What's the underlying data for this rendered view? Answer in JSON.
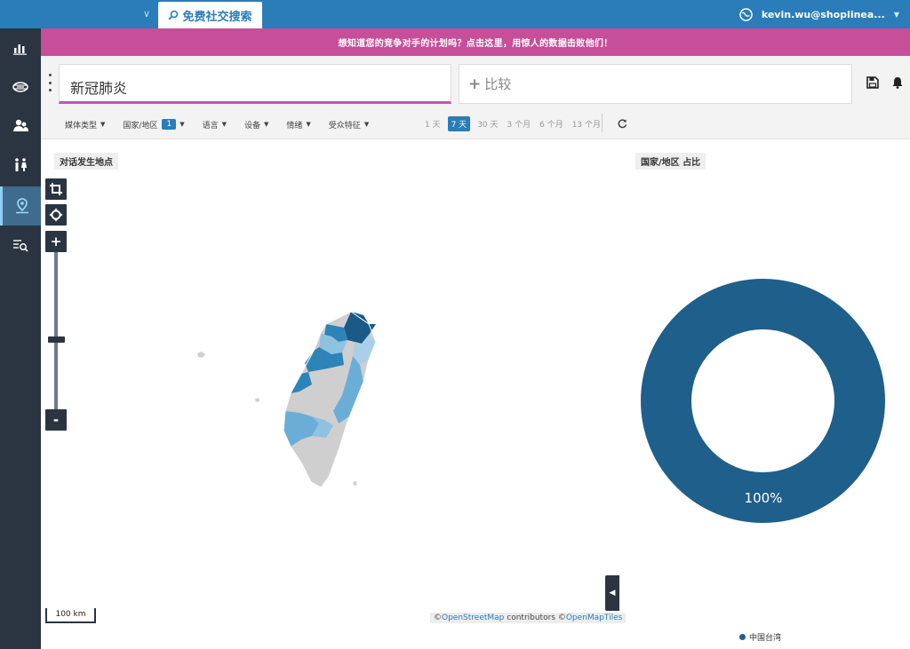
{
  "topbar": {
    "search_tab_label": "免费社交搜索",
    "user_email": "kevin.wu@shoplinea..."
  },
  "banner": {
    "text": "想知道您的竞争对手的计划吗？点击这里，用惊人的数据击败他们！"
  },
  "query": {
    "main_query": "新冠肺炎",
    "compare_label": "比较"
  },
  "filters": [
    {
      "label": "媒体类型"
    },
    {
      "label": "国家/地区",
      "badge": "1"
    },
    {
      "label": "语言"
    },
    {
      "label": "设备"
    },
    {
      "label": "情绪"
    },
    {
      "label": "受众特征"
    }
  ],
  "periods": {
    "options": [
      "1 天",
      "7 天",
      "30 天",
      "3 个月",
      "6 个月",
      "13 个月"
    ],
    "selected": "7 天"
  },
  "map_panel": {
    "title": "对话发生地点",
    "zoom_in": "+",
    "zoom_out": "-",
    "zoom_level": 0.55,
    "scale_label": "100 km",
    "attribution": {
      "prefix1": "©",
      "osm": "OpenStreetMap",
      "mid": " contributors ",
      "prefix2": "©",
      "omt": "OpenMapTiles"
    }
  },
  "donut_panel": {
    "title": "国家/地区 占比",
    "slice_value": 100,
    "slice_label": "100%",
    "legend_label": "中国台湾",
    "slice_color": "#1f5f8b"
  },
  "colors": {
    "topbar": "#2a7db8",
    "sidebar": "#2b3541",
    "banner": "#c74f9a",
    "accent_underline": "#c455b8"
  }
}
